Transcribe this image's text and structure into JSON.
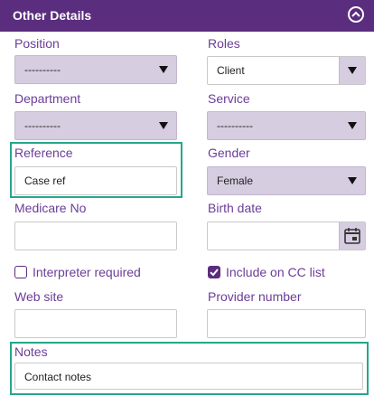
{
  "header": {
    "title": "Other Details"
  },
  "colors": {
    "accent": "#5b2d7e",
    "highlight": "#26a68c"
  },
  "fields": {
    "position": {
      "label": "Position",
      "value": "----------"
    },
    "roles": {
      "label": "Roles",
      "value": "Client"
    },
    "department": {
      "label": "Department",
      "value": "----------"
    },
    "service": {
      "label": "Service",
      "value": "----------"
    },
    "reference": {
      "label": "Reference",
      "value": "Case ref"
    },
    "gender": {
      "label": "Gender",
      "value": "Female"
    },
    "medicare": {
      "label": "Medicare No",
      "value": ""
    },
    "birth_date": {
      "label": "Birth date",
      "value": ""
    },
    "interpreter": {
      "label": "Interpreter required",
      "checked": false
    },
    "cc_list": {
      "label": "Include on CC list",
      "checked": true
    },
    "website": {
      "label": "Web site",
      "value": ""
    },
    "provider": {
      "label": "Provider number",
      "value": ""
    },
    "notes": {
      "label": "Notes",
      "value": "Contact notes"
    }
  }
}
